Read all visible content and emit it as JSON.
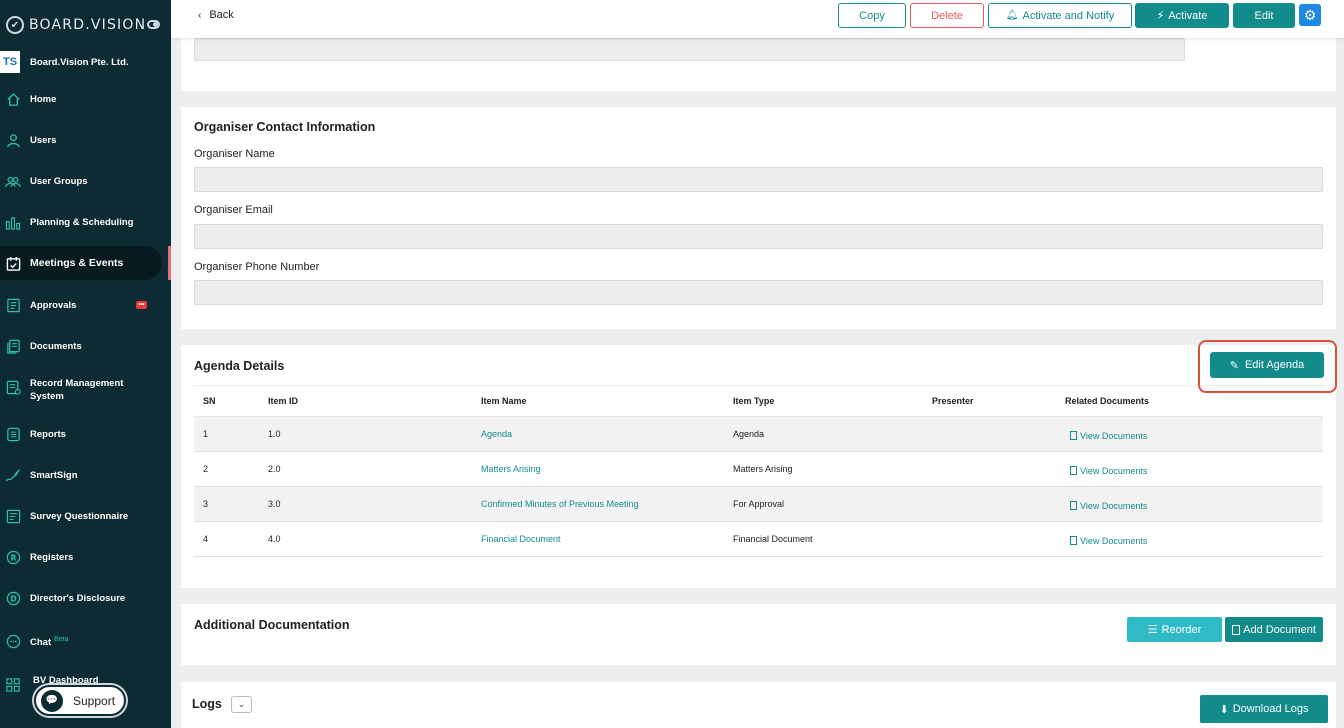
{
  "brand": {
    "name": "BOARD.VISION"
  },
  "org": {
    "logo_text": "TS",
    "name": "Board.Vision Pte. Ltd."
  },
  "sidebar": {
    "items": [
      {
        "label": "Home",
        "icon": "home-icon"
      },
      {
        "label": "Users",
        "icon": "user-icon"
      },
      {
        "label": "User Groups",
        "icon": "users-icon"
      },
      {
        "label": "Planning & Scheduling",
        "icon": "bar-chart-icon"
      },
      {
        "label": "Meetings & Events",
        "icon": "calendar-icon"
      },
      {
        "label": "Approvals",
        "icon": "approval-icon",
        "badge": "•••"
      },
      {
        "label": "Documents",
        "icon": "documents-icon"
      },
      {
        "label": "Record Management System",
        "icon": "records-icon"
      },
      {
        "label": "Reports",
        "icon": "reports-icon"
      },
      {
        "label": "SmartSign",
        "icon": "signature-icon"
      },
      {
        "label": "Survey Questionnaire",
        "icon": "survey-icon"
      },
      {
        "label": "Registers",
        "icon": "registers-icon"
      },
      {
        "label": "Director's Disclosure",
        "icon": "disclosure-icon"
      },
      {
        "label": "Chat",
        "icon": "chat-icon",
        "tag": "Beta"
      },
      {
        "label": "BV Dashboard",
        "icon": "dashboard-icon"
      }
    ],
    "support_label": "Support"
  },
  "topbar": {
    "back_label": "Back",
    "copy_label": "Copy",
    "delete_label": "Delete",
    "activate_notify_label": "Activate and Notify",
    "activate_label": "Activate",
    "edit_label": "Edit"
  },
  "organiser": {
    "title": "Organiser Contact Information",
    "name_label": "Organiser Name",
    "email_label": "Organiser Email",
    "phone_label": "Organiser Phone Number"
  },
  "agenda": {
    "title": "Agenda Details",
    "edit_label": "Edit Agenda",
    "columns": [
      "SN",
      "Item ID",
      "Item Name",
      "Item Type",
      "Presenter",
      "Related Documents"
    ],
    "rows": [
      {
        "sn": "1",
        "id": "1.0",
        "name": "Agenda",
        "type": "Agenda",
        "presenter": "",
        "docs": "View Documents"
      },
      {
        "sn": "2",
        "id": "2.0",
        "name": "Matters Arising",
        "type": "Matters Arising",
        "presenter": "",
        "docs": "View Documents"
      },
      {
        "sn": "3",
        "id": "3.0",
        "name": "Confirmed Minutes of Previous Meeting",
        "type": "For Approval",
        "presenter": "",
        "docs": "View Documents"
      },
      {
        "sn": "4",
        "id": "4.0",
        "name": "Financial Document",
        "type": "Financial Document",
        "presenter": "",
        "docs": "View Documents"
      }
    ]
  },
  "additional": {
    "title": "Additional Documentation",
    "reorder_label": "Reorder",
    "add_label": "Add Document"
  },
  "logs": {
    "title": "Logs",
    "download_label": "Download Logs"
  },
  "colors": {
    "primary": "#128b8b",
    "sidebar": "#0d2b33",
    "danger": "#e85a5a",
    "highlight": "#d9533a"
  }
}
